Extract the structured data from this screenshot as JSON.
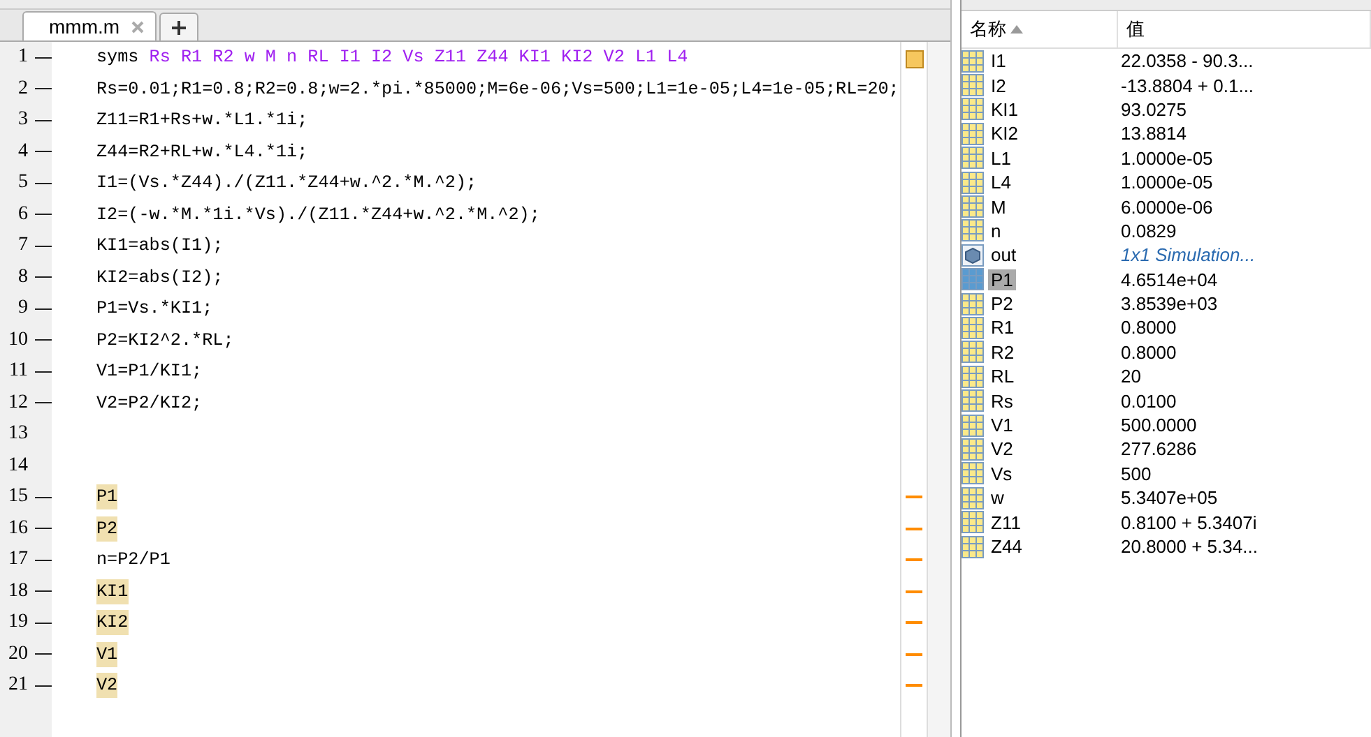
{
  "editor": {
    "tabs": [
      {
        "label": "mmm.m",
        "selected": true
      }
    ],
    "lines": [
      {
        "number": "1",
        "kind": "syms",
        "keyword": "syms",
        "args": "Rs R1 R2 w M n RL I1 I2 Vs Z11 Z44 KI1 KI2 V2 L1 L4",
        "executable": true
      },
      {
        "number": "2",
        "kind": "code",
        "text": "Rs=0.01;R1=0.8;R2=0.8;w=2.*pi.*85000;M=6e-06;Vs=500;L1=1e-05;L4=1e-05;RL=20;",
        "executable": true
      },
      {
        "number": "3",
        "kind": "code",
        "text": "Z11=R1+Rs+w.*L1.*1i;",
        "executable": true
      },
      {
        "number": "4",
        "kind": "code",
        "text": "Z44=R2+RL+w.*L4.*1i;",
        "executable": true
      },
      {
        "number": "5",
        "kind": "code",
        "text": "I1=(Vs.*Z44)./(Z11.*Z44+w.^2.*M.^2);",
        "executable": true
      },
      {
        "number": "6",
        "kind": "code",
        "text": "I2=(-w.*M.*1i.*Vs)./(Z11.*Z44+w.^2.*M.^2);",
        "executable": true
      },
      {
        "number": "7",
        "kind": "code",
        "text": "KI1=abs(I1);",
        "executable": true
      },
      {
        "number": "8",
        "kind": "code",
        "text": "KI2=abs(I2);",
        "executable": true
      },
      {
        "number": "9",
        "kind": "code",
        "text": "P1=Vs.*KI1;",
        "executable": true
      },
      {
        "number": "10",
        "kind": "code",
        "text": "P2=KI2^2.*RL;",
        "executable": true
      },
      {
        "number": "11",
        "kind": "code",
        "text": "V1=P1/KI1;",
        "executable": true
      },
      {
        "number": "12",
        "kind": "code",
        "text": "V2=P2/KI2;",
        "executable": true
      },
      {
        "number": "13",
        "kind": "code",
        "executable": false
      },
      {
        "number": "14",
        "kind": "code",
        "executable": false
      },
      {
        "number": "15",
        "kind": "code",
        "text": "P1",
        "executable": true,
        "highlighted": true,
        "warning": true
      },
      {
        "number": "16",
        "kind": "code",
        "text": "P2",
        "executable": true,
        "highlighted": true,
        "warning": true
      },
      {
        "number": "17",
        "kind": "code",
        "text": "n=P2/P1",
        "executable": true,
        "highlighted": false,
        "warning": true
      },
      {
        "number": "18",
        "kind": "code",
        "text": "KI1",
        "executable": true,
        "highlighted": true,
        "warning": true
      },
      {
        "number": "19",
        "kind": "code",
        "text": "KI2",
        "executable": true,
        "highlighted": true,
        "warning": true
      },
      {
        "number": "20",
        "kind": "code",
        "text": "V1",
        "executable": true,
        "highlighted": true,
        "warning": true
      },
      {
        "number": "21",
        "kind": "code",
        "text": "V2",
        "executable": true,
        "highlighted": true,
        "warning": true
      }
    ]
  },
  "workspace": {
    "columns": [
      {
        "label": "名称",
        "sorted": true
      },
      {
        "label": "值",
        "sorted": false
      }
    ],
    "rows": [
      {
        "name": "I1",
        "value": "22.0358 - 90.3...",
        "kind": "matrix",
        "selected": false
      },
      {
        "name": "I2",
        "value": "-13.8804 + 0.1...",
        "kind": "matrix",
        "selected": false
      },
      {
        "name": "KI1",
        "value": "93.0275",
        "kind": "matrix",
        "selected": false
      },
      {
        "name": "KI2",
        "value": "13.8814",
        "kind": "matrix",
        "selected": false
      },
      {
        "name": "L1",
        "value": "1.0000e-05",
        "kind": "matrix",
        "selected": false
      },
      {
        "name": "L4",
        "value": "1.0000e-05",
        "kind": "matrix",
        "selected": false
      },
      {
        "name": "M",
        "value": "6.0000e-06",
        "kind": "matrix",
        "selected": false
      },
      {
        "name": "n",
        "value": "0.0829",
        "kind": "matrix",
        "selected": false
      },
      {
        "name": "out",
        "value": "1x1 Simulation...",
        "kind": "object",
        "selected": false
      },
      {
        "name": "P1",
        "value": "4.6514e+04",
        "kind": "matrix",
        "selected": true
      },
      {
        "name": "P2",
        "value": "3.8539e+03",
        "kind": "matrix",
        "selected": false
      },
      {
        "name": "R1",
        "value": "0.8000",
        "kind": "matrix",
        "selected": false
      },
      {
        "name": "R2",
        "value": "0.8000",
        "kind": "matrix",
        "selected": false
      },
      {
        "name": "RL",
        "value": "20",
        "kind": "matrix",
        "selected": false
      },
      {
        "name": "Rs",
        "value": "0.0100",
        "kind": "matrix",
        "selected": false
      },
      {
        "name": "V1",
        "value": "500.0000",
        "kind": "matrix",
        "selected": false
      },
      {
        "name": "V2",
        "value": "277.6286",
        "kind": "matrix",
        "selected": false
      },
      {
        "name": "Vs",
        "value": "500",
        "kind": "matrix",
        "selected": false
      },
      {
        "name": "w",
        "value": "5.3407e+05",
        "kind": "matrix",
        "selected": false
      },
      {
        "name": "Z11",
        "value": "0.8100 + 5.3407i",
        "kind": "matrix",
        "selected": false
      },
      {
        "name": "Z44",
        "value": "20.8000 + 5.34...",
        "kind": "matrix",
        "selected": false
      }
    ]
  }
}
